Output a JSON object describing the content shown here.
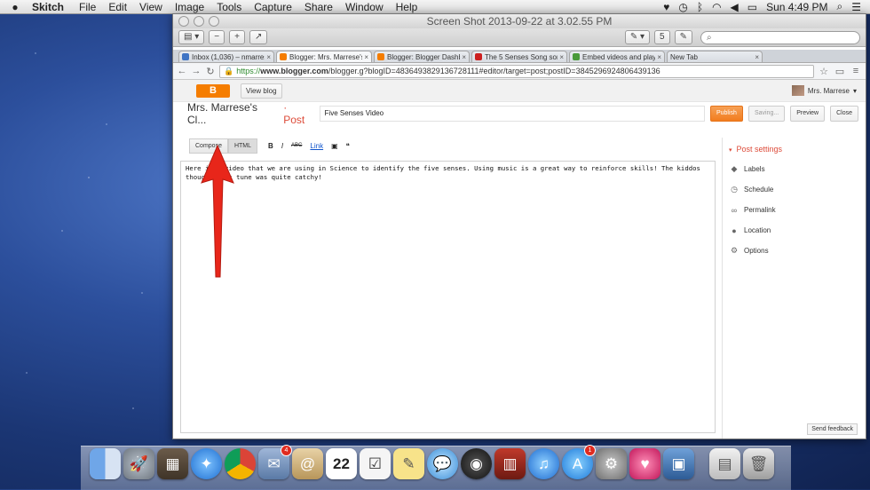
{
  "menubar": {
    "app": "Skitch",
    "items": [
      "File",
      "Edit",
      "View",
      "Image",
      "Tools",
      "Capture",
      "Share",
      "Window",
      "Help"
    ],
    "clock": "Sun 4:49 PM",
    "status_icons": [
      "heart-icon",
      "clock-icon",
      "bluetooth-icon",
      "wifi-icon",
      "volume-icon",
      "battery-icon",
      "search-icon",
      "list-icon"
    ]
  },
  "window": {
    "title": "Screen Shot 2013-09-22 at 3.02.55 PM"
  },
  "browser": {
    "tabs": [
      {
        "label": "Inbox (1,036) – nmarrese@",
        "color": "#3f74c4"
      },
      {
        "label": "Blogger: Mrs. Marrese's Cl",
        "color": "#f57d00"
      },
      {
        "label": "Blogger: Blogger Dashboard",
        "color": "#f57d00"
      },
      {
        "label": "The 5 Senses Song song b",
        "color": "#cc1f1f"
      },
      {
        "label": "Embed videos and playlists",
        "color": "#4a9a3a"
      },
      {
        "label": "New Tab",
        "color": "transparent"
      }
    ],
    "url_scheme": "https://",
    "url_host": "www.blogger.com",
    "url_path": "/blogger.g?blogID=4836493829136728111#editor/target=post;postID=3845296924806439136"
  },
  "blogger": {
    "logo_glyph": "B",
    "view_blog": "View blog",
    "user_name": "Mrs. Marrese",
    "blog_name": "Mrs. Marrese's Cl...",
    "post_label": "· Post",
    "post_title": "Five Senses Video",
    "buttons": {
      "publish": "Publish",
      "saving": "Saving...",
      "preview": "Preview",
      "close": "Close"
    },
    "modes": {
      "compose": "Compose",
      "html": "HTML"
    },
    "format": {
      "bold": "B",
      "italic": "I",
      "strike": "ABC",
      "link": "Link",
      "quote": "❝"
    },
    "body": "Here is a video that we are using in Science to identify the five senses. Using music is a great way to reinforce skills! The kiddos thought this tune was quite catchy!",
    "settings_title": "Post settings",
    "settings": [
      {
        "label": "Labels",
        "icon": "tag-icon"
      },
      {
        "label": "Schedule",
        "icon": "clock-icon"
      },
      {
        "label": "Permalink",
        "icon": "link-icon"
      },
      {
        "label": "Location",
        "icon": "location-pin-icon"
      },
      {
        "label": "Options",
        "icon": "gear-icon"
      }
    ],
    "send_feedback": "Send feedback"
  },
  "dock": {
    "badges": {
      "mail": "4",
      "appstore": "1"
    },
    "calendar_day": "22"
  },
  "colors": {
    "accent": "#f57d00",
    "link": "#1155cc",
    "post_red": "#dd4b39",
    "arrow": "#e8261a"
  }
}
